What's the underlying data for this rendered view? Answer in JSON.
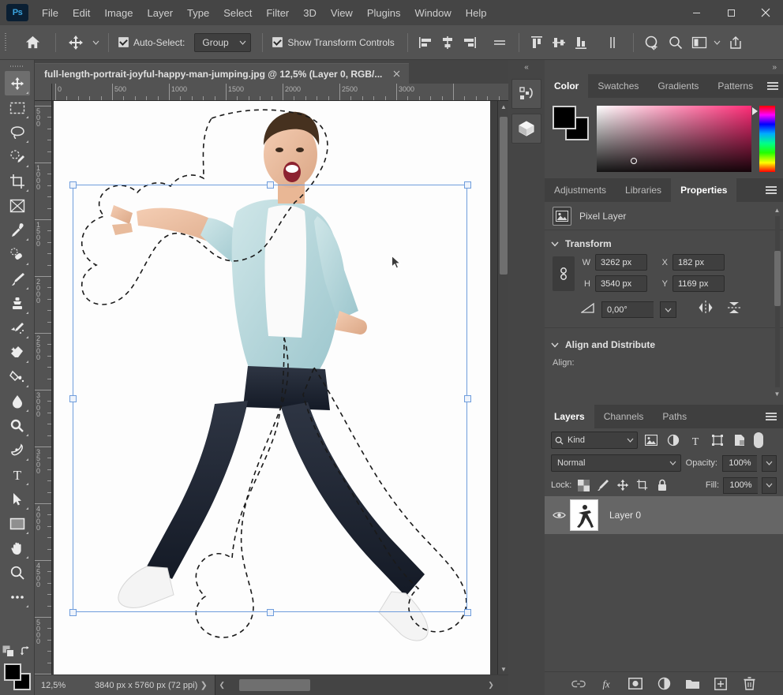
{
  "app": {
    "logo": "Ps",
    "logo_color": "#31a8ff",
    "bg_color": "#535353",
    "panel_color": "#4a4a4a"
  },
  "menubar": {
    "items": [
      {
        "label": "File"
      },
      {
        "label": "Edit"
      },
      {
        "label": "Image"
      },
      {
        "label": "Layer"
      },
      {
        "label": "Type"
      },
      {
        "label": "Select"
      },
      {
        "label": "Filter"
      },
      {
        "label": "3D"
      },
      {
        "label": "View"
      },
      {
        "label": "Plugins"
      },
      {
        "label": "Window"
      },
      {
        "label": "Help"
      }
    ],
    "window_controls": {
      "minimize": "minimize-icon",
      "maximize": "maximize-icon",
      "close": "close-icon"
    }
  },
  "options_bar": {
    "home_icon": "home-icon",
    "tool_icon": "move-tool-icon",
    "auto_select_checked": true,
    "auto_select_label": "Auto-Select:",
    "auto_select_scope": "Group",
    "show_transform_checked": true,
    "show_transform_label": "Show Transform Controls",
    "align_buttons": [
      "align-left-edges-icon",
      "align-horizontal-centers-icon",
      "align-right-edges-icon",
      "distribute-horizontal-icon",
      "align-top-edges-icon",
      "align-vertical-centers-icon",
      "align-bottom-edges-icon",
      "distribute-vertical-icon"
    ],
    "extra_buttons": [
      "3d-mode-icon",
      "search-icon",
      "workspace-icon",
      "share-icon"
    ]
  },
  "toolbar": {
    "tools": [
      {
        "name": "move-tool",
        "active": true
      },
      {
        "name": "rectangular-marquee-tool",
        "active": false
      },
      {
        "name": "lasso-tool",
        "active": false
      },
      {
        "name": "object-selection-tool",
        "active": false
      },
      {
        "name": "crop-tool",
        "active": false
      },
      {
        "name": "frame-tool",
        "active": false
      },
      {
        "name": "eyedropper-tool",
        "active": false
      },
      {
        "name": "spot-healing-brush-tool",
        "active": false
      },
      {
        "name": "brush-tool",
        "active": false
      },
      {
        "name": "clone-stamp-tool",
        "active": false
      },
      {
        "name": "history-brush-tool",
        "active": false
      },
      {
        "name": "eraser-tool",
        "active": false
      },
      {
        "name": "gradient-tool",
        "active": false
      },
      {
        "name": "blur-tool",
        "active": false
      },
      {
        "name": "dodge-tool",
        "active": false
      },
      {
        "name": "pen-tool",
        "active": false
      },
      {
        "name": "horizontal-type-tool",
        "active": false
      },
      {
        "name": "path-selection-tool",
        "active": false
      },
      {
        "name": "rectangle-tool",
        "active": false
      },
      {
        "name": "hand-tool",
        "active": false
      },
      {
        "name": "zoom-tool",
        "active": false
      },
      {
        "name": "edit-toolbar-tool",
        "active": false
      }
    ],
    "quick_mask_icon": "quick-mask-icon",
    "swap_colors_icon": "swap-colors-icon",
    "foreground_color": "#000000",
    "background_color": "#000000"
  },
  "document": {
    "tab_title": "full-length-portrait-joyful-happy-man-jumping.jpg @ 12,5% (Layer 0, RGB/...",
    "close_icon": "close-icon",
    "ruler_units_h": [
      "0",
      "500",
      "1000",
      "1500",
      "2000",
      "2500",
      "3000"
    ],
    "ruler_units_v": [
      "500",
      "1000",
      "1500",
      "2000",
      "2500",
      "3000",
      "3500",
      "4000",
      "4500",
      "5000"
    ],
    "selection_active": true,
    "transform_handles": 8
  },
  "status_bar": {
    "zoom": "12,5%",
    "doc_size": "3840 px x 5760 px (72 ppi)",
    "next_arrow": "chevron-right-icon",
    "prev_arrow": "chevron-left-icon"
  },
  "mini_dock": {
    "collapse_icon": "collapse-panels-icon",
    "buttons": [
      {
        "name": "history-actions-icon"
      },
      {
        "name": "3d-cube-icon"
      }
    ]
  },
  "color_panel": {
    "tabs": [
      {
        "label": "Color",
        "active": true
      },
      {
        "label": "Swatches",
        "active": false
      },
      {
        "label": "Gradients",
        "active": false
      },
      {
        "label": "Patterns",
        "active": false
      }
    ],
    "menu_icon": "panel-menu-icon",
    "foreground": "#000000",
    "background": "#000000",
    "ramp_color": "#ff2d78"
  },
  "properties_panel": {
    "tabs": [
      {
        "label": "Adjustments",
        "active": false
      },
      {
        "label": "Libraries",
        "active": false
      },
      {
        "label": "Properties",
        "active": true
      }
    ],
    "menu_icon": "panel-menu-icon",
    "layer_type_icon": "pixel-layer-icon",
    "layer_type": "Pixel Layer",
    "transform": {
      "section_label": "Transform",
      "link_icon": "link-dimensions-icon",
      "w_label": "W",
      "w_value": "3262 px",
      "h_label": "H",
      "h_value": "3540 px",
      "x_label": "X",
      "x_value": "182 px",
      "y_label": "Y",
      "y_value": "1169 px",
      "angle_icon": "angle-icon",
      "angle_value": "0,00°",
      "angle_chevron": "chevron-down-icon",
      "flip_horizontal_icon": "flip-horizontal-icon",
      "flip_vertical_icon": "flip-vertical-icon"
    },
    "align_distribute": {
      "section_label": "Align and Distribute",
      "align_label": "Align:"
    }
  },
  "layers_panel": {
    "tabs": [
      {
        "label": "Layers",
        "active": true
      },
      {
        "label": "Channels",
        "active": false
      },
      {
        "label": "Paths",
        "active": false
      }
    ],
    "menu_icon": "panel-menu-icon",
    "filter": {
      "search_icon": "search-icon",
      "kind_label": "Kind",
      "chevron": "chevron-down-icon",
      "type_filters": [
        "filter-pixel-icon",
        "filter-adjustment-icon",
        "filter-type-icon",
        "filter-shape-icon",
        "filter-smart-object-icon"
      ],
      "toggle_icon": "filter-toggle-switch"
    },
    "blend_mode": "Normal",
    "blend_chevron": "chevron-down-icon",
    "opacity_label": "Opacity:",
    "opacity_value": "100%",
    "lock_label": "Lock:",
    "lock_buttons": [
      "lock-transparent-pixels-icon",
      "lock-image-pixels-icon",
      "lock-position-icon",
      "lock-artboard-nesting-icon",
      "lock-all-icon"
    ],
    "fill_label": "Fill:",
    "fill_value": "100%",
    "layers": [
      {
        "name": "Layer 0",
        "visible": true,
        "visibility_icon": "eye-icon",
        "selected": true
      }
    ],
    "footer_buttons": [
      "link-layers-icon",
      "layer-styles-fx-icon",
      "layer-mask-icon",
      "adjustment-layer-icon",
      "new-group-icon",
      "new-layer-icon",
      "delete-layer-icon"
    ]
  }
}
